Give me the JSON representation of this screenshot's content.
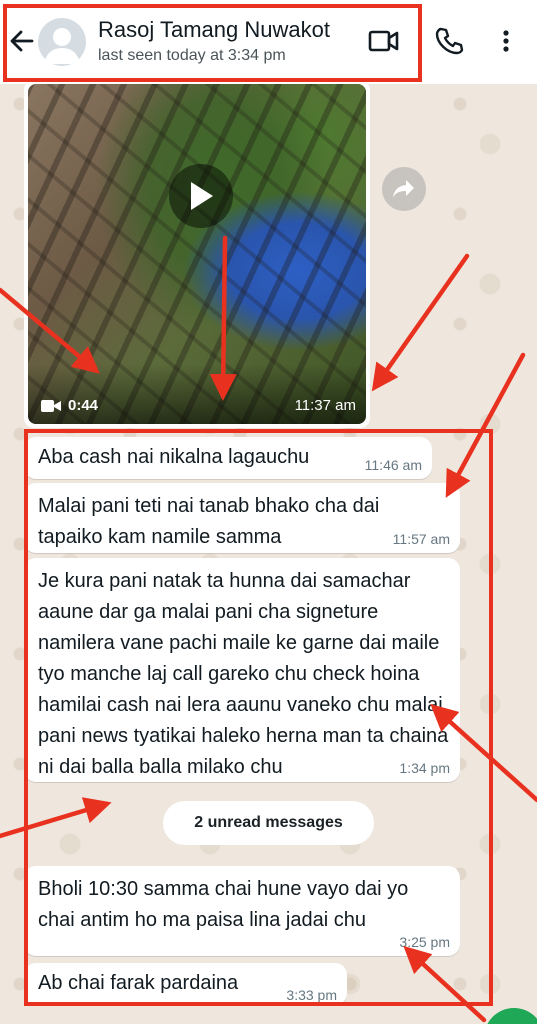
{
  "header": {
    "contact_name": "Rasoj Tamang Nuwakot",
    "last_seen": "last seen today at 3:34 pm"
  },
  "video_message": {
    "duration": "0:44",
    "time": "11:37 am"
  },
  "messages": [
    {
      "text": "Aba cash nai nikalna lagauchu",
      "time": "11:46 am"
    },
    {
      "text": "Malai pani teti nai tanab bhako cha dai tapaiko kam namile samma",
      "time": "11:57 am"
    },
    {
      "text": "Je kura pani natak ta hunna dai samachar aaune dar ga malai pani cha signeture namilera vane pachi maile ke garne dai maile tyo manche laj call gareko chu check hoina hamilai cash nai lera aaunu vaneko chu malai pani news tyatikai haleko herna man ta chaina ni dai balla balla milako chu",
      "time": "1:34 pm"
    },
    {
      "text": "Bholi 10:30 samma chai hune vayo dai yo chai antim ho ma paisa lina jadai chu",
      "time": "3:25 pm"
    },
    {
      "text": "Ab chai farak pardaina",
      "time": "3:33 pm"
    }
  ],
  "unread_label": "2 unread messages",
  "colors": {
    "header_bg": "#ffffff",
    "chat_bg": "#efe7de",
    "bubble_bg": "#ffffff",
    "annotation_red": "#e8321f",
    "fab_green": "#1fa855"
  },
  "icons": [
    "back-arrow-icon",
    "avatar-placeholder-icon",
    "video-call-icon",
    "phone-icon",
    "more-vert-icon",
    "play-icon",
    "video-camera-icon",
    "forward-icon"
  ]
}
